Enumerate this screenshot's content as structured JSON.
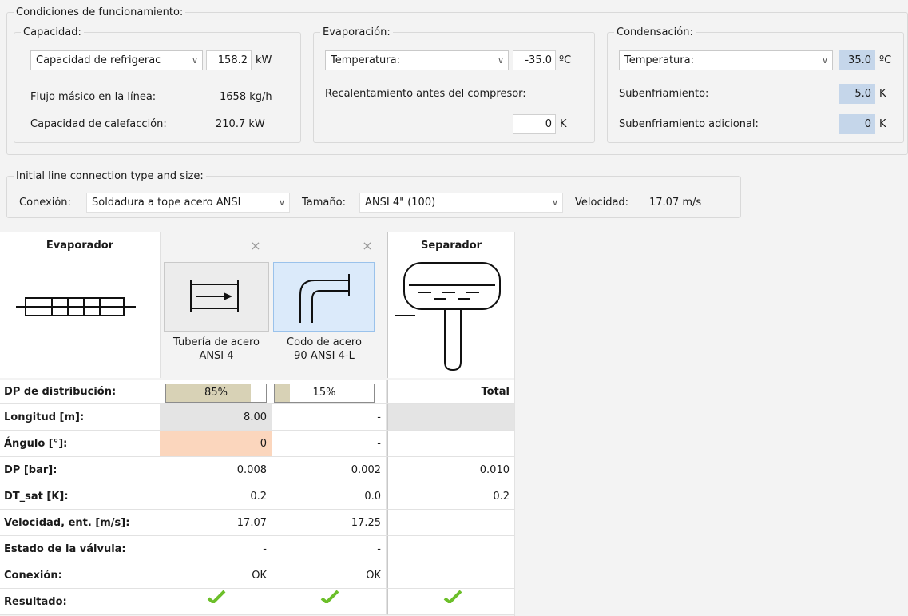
{
  "operating_conditions": {
    "title": "Condiciones de funcionamiento:",
    "capacity": {
      "title": "Capacidad:",
      "type_value": "Capacidad de refrigerac",
      "value": "158.2",
      "unit": "kW",
      "mass_flow_label": "Flujo másico en la línea:",
      "mass_flow_value": "1658 kg/h",
      "heating_label": "Capacidad de calefacción:",
      "heating_value": "210.7 kW"
    },
    "evaporation": {
      "title": "Evaporación:",
      "type_value": "Temperatura:",
      "value": "-35.0",
      "unit": "ºC",
      "superheat_label": "Recalentamiento antes del compresor:",
      "superheat_value": "0",
      "superheat_unit": "K"
    },
    "condensation": {
      "title": "Condensación:",
      "type_value": "Temperatura:",
      "value": "35.0",
      "unit": "ºC",
      "subcooling_label": "Subenfriamiento:",
      "subcooling_value": "5.0",
      "subcooling_unit": "K",
      "extra_subcooling_label": "Subenfriamiento adicional:",
      "extra_subcooling_value": "0",
      "extra_subcooling_unit": "K"
    }
  },
  "connection": {
    "title": "Initial line connection type and size:",
    "type_label": "Conexión:",
    "type_value": "Soldadura a tope acero ANSI",
    "size_label": "Tamaño:",
    "size_value": "ANSI 4\" (100)",
    "velocity_label": "Velocidad:",
    "velocity_value": "17.07 m/s"
  },
  "table": {
    "headers": {
      "evaporator": "Evaporador",
      "separator": "Separador"
    },
    "close_symbol": "×",
    "components": [
      {
        "label_line1": "Tubería de acero",
        "label_line2": "ANSI 4"
      },
      {
        "label_line1": "Codo de acero",
        "label_line2": "90 ANSI 4-L"
      }
    ],
    "distribution": {
      "label": "DP de distribución:",
      "pct1": "85%",
      "pct1_value": 0.85,
      "pct2": "15%",
      "pct2_value": 0.15,
      "total": "Total"
    },
    "rows": [
      {
        "label": "Longitud [m]:",
        "c1": "8.00",
        "c2": "-",
        "c3": ""
      },
      {
        "label": "Ángulo [°]:",
        "c1": "0",
        "c2": "-",
        "c3": ""
      },
      {
        "label": "DP [bar]:",
        "c1": "0.008",
        "c2": "0.002",
        "c3": "0.010"
      },
      {
        "label": "DT_sat [K]:",
        "c1": "0.2",
        "c2": "0.0",
        "c3": "0.2"
      },
      {
        "label": "Velocidad, ent. [m/s]:",
        "c1": "17.07",
        "c2": "17.25",
        "c3": ""
      },
      {
        "label": "Estado de la válvula:",
        "c1": "-",
        "c2": "-",
        "c3": ""
      },
      {
        "label": "Conexión:",
        "c1": "OK",
        "c2": "OK",
        "c3": ""
      },
      {
        "label": "Resultado:",
        "c1": "",
        "c2": "",
        "c3": ""
      }
    ]
  },
  "colors": {
    "accent_blue": "#c5d6ea",
    "selected": "#dbeafa",
    "highlight_orange": "#fbd6bd",
    "check_green": "#6cbf2a"
  }
}
